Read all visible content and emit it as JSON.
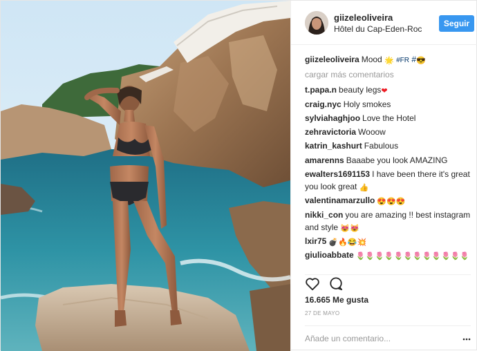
{
  "header": {
    "username": "giizeleoliveira",
    "location": "Hôtel du Cap-Eden-Roc",
    "follow_label": "Seguir"
  },
  "caption": {
    "username": "giizeleoliveira",
    "text": "Mood ",
    "tag1": "#FR",
    "tag2": "#"
  },
  "load_more": "cargar más comentarios",
  "comments": [
    {
      "username": "t.papa.n",
      "text": "beauty legs",
      "emoji": "❤"
    },
    {
      "username": "craig.nyc",
      "text": "Holy smokes",
      "emoji": ""
    },
    {
      "username": "sylviahaghjoo",
      "text": "Love the Hotel",
      "emoji": ""
    },
    {
      "username": "zehravictoria",
      "text": "Wooow",
      "emoji": ""
    },
    {
      "username": "katrin_kashurt",
      "text": "Fabulous",
      "emoji": ""
    },
    {
      "username": "amarenns",
      "text": "Baaabe you look AMAZING",
      "emoji": ""
    },
    {
      "username": "ewalters1691153",
      "text": "I have been there it's great you look great",
      "emoji": "👍"
    },
    {
      "username": "valentinamarzullo",
      "text": "",
      "emoji": "😍😍😍"
    },
    {
      "username": "nikki_con",
      "text": "you are amazing !! best instagram and style",
      "emoji": "😻😻"
    },
    {
      "username": "lxir75",
      "text": "",
      "emoji": "💣🔥😂💥"
    },
    {
      "username": "giulioabbate",
      "text": "",
      "emoji": "🌷🌷🌷🌷🌷🌷🌷🌷🌷🌷🌷🌷"
    }
  ],
  "likes": "16.665 Me gusta",
  "date": "27 DE MAYO",
  "comment_placeholder": "Añade un comentario...",
  "colors": {
    "follow": "#3897f0",
    "muted": "#999999",
    "heart": "#ed1c24"
  },
  "icons": {
    "like": "heart-outline-icon",
    "comment": "speech-bubble-icon",
    "more": "more-dots-icon"
  }
}
